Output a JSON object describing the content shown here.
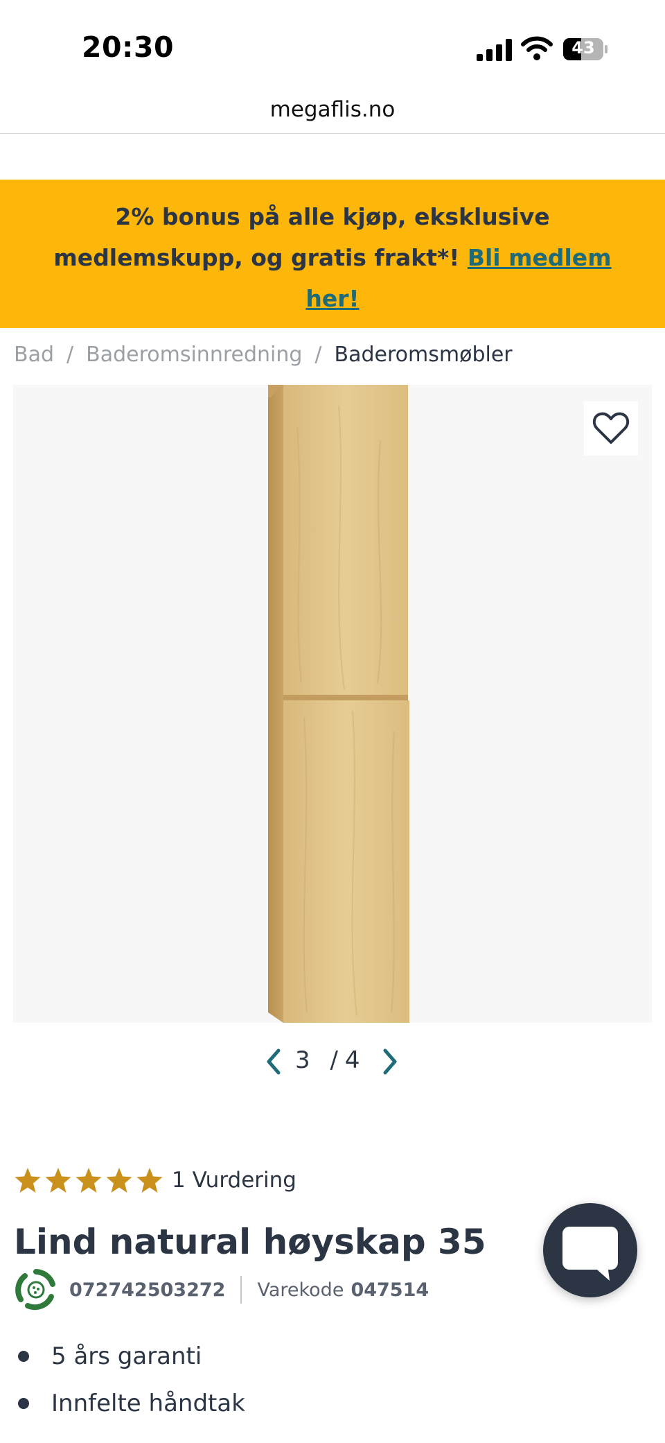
{
  "status_bar": {
    "time": "20:30",
    "battery": "43"
  },
  "browser": {
    "url": "megaflis.no"
  },
  "banner": {
    "text": "2% bonus på alle kjøp, eksklusive medlemskupp, og gratis frakt*!",
    "link": "Bli medlem her!",
    "background": "#fcb70a",
    "link_color": "#1f6c78"
  },
  "breadcrumb": {
    "items": [
      "Bad",
      "Baderomsinnredning",
      "Baderomsmøbler"
    ],
    "separator": "/"
  },
  "gallery": {
    "current": "3",
    "total": "4",
    "separator": "/",
    "favorite_icon": "heart-outline-icon"
  },
  "rating": {
    "stars": 5,
    "max": 5,
    "label": "1 Vurdering",
    "star_color": "#c9901b"
  },
  "product": {
    "title": "Lind natural høyskap 35",
    "ean": "072742503272",
    "item_code_label": "Varekode",
    "item_code": "047514"
  },
  "features": [
    "5 års garanti",
    "Innfelte håndtak"
  ],
  "chat": {
    "icon": "chat-bubble-icon"
  }
}
